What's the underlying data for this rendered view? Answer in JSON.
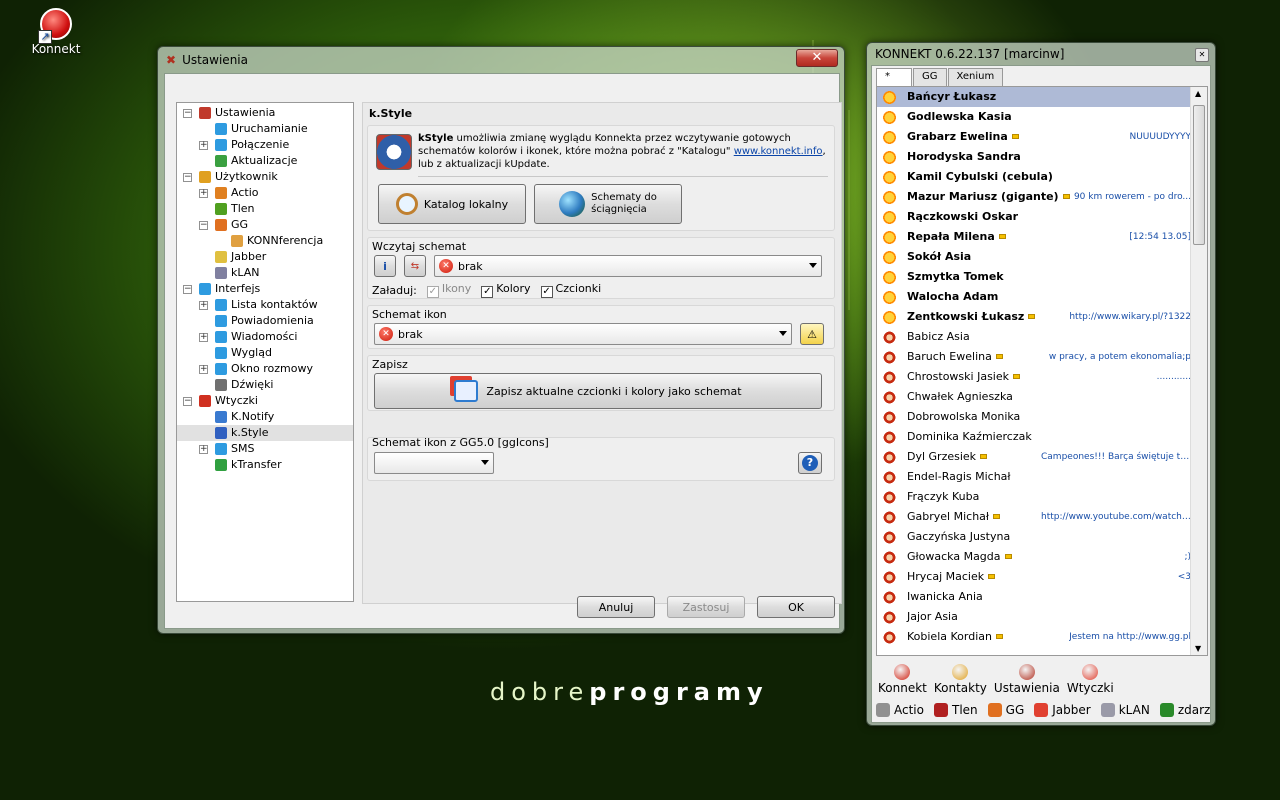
{
  "desktop": {
    "icon_label": "Konnekt",
    "brand_light": "dobre",
    "brand_bold": "programy"
  },
  "settings": {
    "title": "Ustawienia",
    "close_glyph": "✕",
    "tree": [
      {
        "label": "Ustawienia",
        "level": 0,
        "toggle": "−",
        "color": "#c0392b"
      },
      {
        "label": "Uruchamianie",
        "level": 1,
        "toggle": "",
        "color": "#2e9be0"
      },
      {
        "label": "Połączenie",
        "level": 1,
        "toggle": "+",
        "color": "#2e9be0"
      },
      {
        "label": "Aktualizacje",
        "level": 1,
        "toggle": "",
        "color": "#3aa040"
      },
      {
        "label": "Użytkownik",
        "level": 0,
        "toggle": "−",
        "color": "#e0a020"
      },
      {
        "label": "Actio",
        "level": 1,
        "toggle": "+",
        "color": "#e08020"
      },
      {
        "label": "Tlen",
        "level": 1,
        "toggle": "",
        "color": "#50a020"
      },
      {
        "label": "GG",
        "level": 1,
        "toggle": "−",
        "color": "#e07020"
      },
      {
        "label": "KONNferencja",
        "level": 2,
        "toggle": "",
        "color": "#e0a040"
      },
      {
        "label": "Jabber",
        "level": 1,
        "toggle": "",
        "color": "#e0c040"
      },
      {
        "label": "kLAN",
        "level": 1,
        "toggle": "",
        "color": "#8080a0"
      },
      {
        "label": "Interfejs",
        "level": 0,
        "toggle": "−",
        "color": "#2e9be0"
      },
      {
        "label": "Lista kontaktów",
        "level": 1,
        "toggle": "+",
        "color": "#2e9be0"
      },
      {
        "label": "Powiadomienia",
        "level": 1,
        "toggle": "",
        "color": "#2e9be0"
      },
      {
        "label": "Wiadomości",
        "level": 1,
        "toggle": "+",
        "color": "#2e9be0"
      },
      {
        "label": "Wygląd",
        "level": 1,
        "toggle": "",
        "color": "#2e9be0"
      },
      {
        "label": "Okno rozmowy",
        "level": 1,
        "toggle": "+",
        "color": "#2e9be0"
      },
      {
        "label": "Dźwięki",
        "level": 1,
        "toggle": "",
        "color": "#707070"
      },
      {
        "label": "Wtyczki",
        "level": 0,
        "toggle": "−",
        "color": "#d03020"
      },
      {
        "label": "K.Notify",
        "level": 1,
        "toggle": "",
        "color": "#3a7ad0"
      },
      {
        "label": "k.Style",
        "level": 1,
        "toggle": "",
        "color": "#3060c0",
        "selected": true
      },
      {
        "label": "SMS",
        "level": 1,
        "toggle": "+",
        "color": "#2e9be0"
      },
      {
        "label": "kTransfer",
        "level": 1,
        "toggle": "",
        "color": "#30a040"
      }
    ],
    "panel": {
      "heading": "k.Style",
      "intro_bold": "kStyle",
      "intro_text": " umożliwia zmianę wyglądu Konnekta przez wczytywanie gotowych schematów kolorów i ikonek, które można pobrać z \"Katalogu\" ",
      "intro_link": "www.konnekt.info",
      "intro_tail": ",",
      "intro_line3": "lub z aktualizacji kUpdate.",
      "catalog_button": "Katalog lokalny",
      "download_button_1": "Schematy do",
      "download_button_2": "ściągnięcia",
      "load_scheme_label": "Wczytaj schemat",
      "load_scheme_value": "brak",
      "load_label": "Załaduj:",
      "chk_icons": "Ikony",
      "chk_colors": "Kolory",
      "chk_fonts": "Czcionki",
      "icon_scheme_label": "Schemat ikon",
      "icon_scheme_value": "brak",
      "save_label": "Zapisz",
      "save_button": "Zapisz aktualne czcionki i kolory jako schemat",
      "gg5_label": "Schemat ikon z GG5.0 [ggIcons]",
      "gg5_value": ""
    },
    "buttons": {
      "cancel": "Anuluj",
      "apply": "Zastosuj",
      "ok": "OK"
    }
  },
  "contacts": {
    "title": "KONNEKT 0.6.22.137 [marcinw]",
    "close_glyph": "✕",
    "tabs": [
      "*",
      "GG",
      "Xenium"
    ],
    "list": [
      {
        "name": "Bańcyr Łukasz",
        "status": "",
        "online": true,
        "highlight": true,
        "note": false
      },
      {
        "name": "Godlewska Kasia",
        "status": "",
        "online": true,
        "note": false
      },
      {
        "name": "Grabarz Ewelina",
        "status": "NUUUUDYYYY",
        "online": true,
        "note": true
      },
      {
        "name": "Horodyska Sandra",
        "status": "",
        "online": true,
        "note": false
      },
      {
        "name": "Kamil Cybulski (cebula)",
        "status": "",
        "online": true,
        "note": false
      },
      {
        "name": "Mazur Mariusz (gigante)",
        "status": "90 km rowerem - po dro...",
        "online": true,
        "note": true
      },
      {
        "name": "Rączkowski Oskar",
        "status": "",
        "online": true,
        "note": false
      },
      {
        "name": "Repała Milena",
        "status": "[12:54 13.05]",
        "online": true,
        "note": true
      },
      {
        "name": "Sokół Asia",
        "status": "",
        "online": true,
        "note": false
      },
      {
        "name": "Szmytka Tomek",
        "status": "",
        "online": true,
        "note": false
      },
      {
        "name": "Walocha Adam",
        "status": "",
        "online": true,
        "note": false
      },
      {
        "name": "Zentkowski Łukasz",
        "status": "http://www.wikary.pl/?1322",
        "online": true,
        "note": true
      },
      {
        "name": "Babicz Asia",
        "status": "",
        "online": false,
        "note": false
      },
      {
        "name": "Baruch Ewelina",
        "status": "w pracy, a potem ekonomalia;p",
        "online": false,
        "note": true
      },
      {
        "name": "Chrostowski Jasiek",
        "status": "............",
        "online": false,
        "note": true
      },
      {
        "name": "Chwałek Agnieszka",
        "status": "",
        "online": false,
        "note": false
      },
      {
        "name": "Dobrowolska Monika",
        "status": "",
        "online": false,
        "note": false
      },
      {
        "name": "Dominika Kaźmierczak",
        "status": "",
        "online": false,
        "note": false
      },
      {
        "name": "Dyl Grzesiek",
        "status": "Campeones!!! Barça świętuje trzeci mistrzo...",
        "online": false,
        "note": true
      },
      {
        "name": "Endel-Ragis Michał",
        "status": "",
        "online": false,
        "note": false
      },
      {
        "name": "Frączyk Kuba",
        "status": "",
        "online": false,
        "note": false
      },
      {
        "name": "Gabryel Michał",
        "status": "http://www.youtube.com/watch?v=gUL...",
        "online": false,
        "note": true
      },
      {
        "name": "Gaczyńska Justyna",
        "status": "",
        "online": false,
        "note": false
      },
      {
        "name": "Głowacka Magda",
        "status": ";)",
        "online": false,
        "note": true
      },
      {
        "name": "Hrycaj Maciek",
        "status": "<3",
        "online": false,
        "note": true
      },
      {
        "name": "Iwanicka Ania",
        "status": "",
        "online": false,
        "note": false
      },
      {
        "name": "Jajor Asia",
        "status": "",
        "online": false,
        "note": false
      },
      {
        "name": "Kobiela Kordian",
        "status": "Jestem na http://www.gg.pl",
        "online": false,
        "note": true
      }
    ],
    "toolbar": [
      "Konnekt",
      "Kontakty",
      "Ustawienia",
      "Wtyczki"
    ],
    "protocols": [
      "Actio",
      "Tlen",
      "GG",
      "Jabber",
      "kLAN",
      "zdarz"
    ]
  }
}
